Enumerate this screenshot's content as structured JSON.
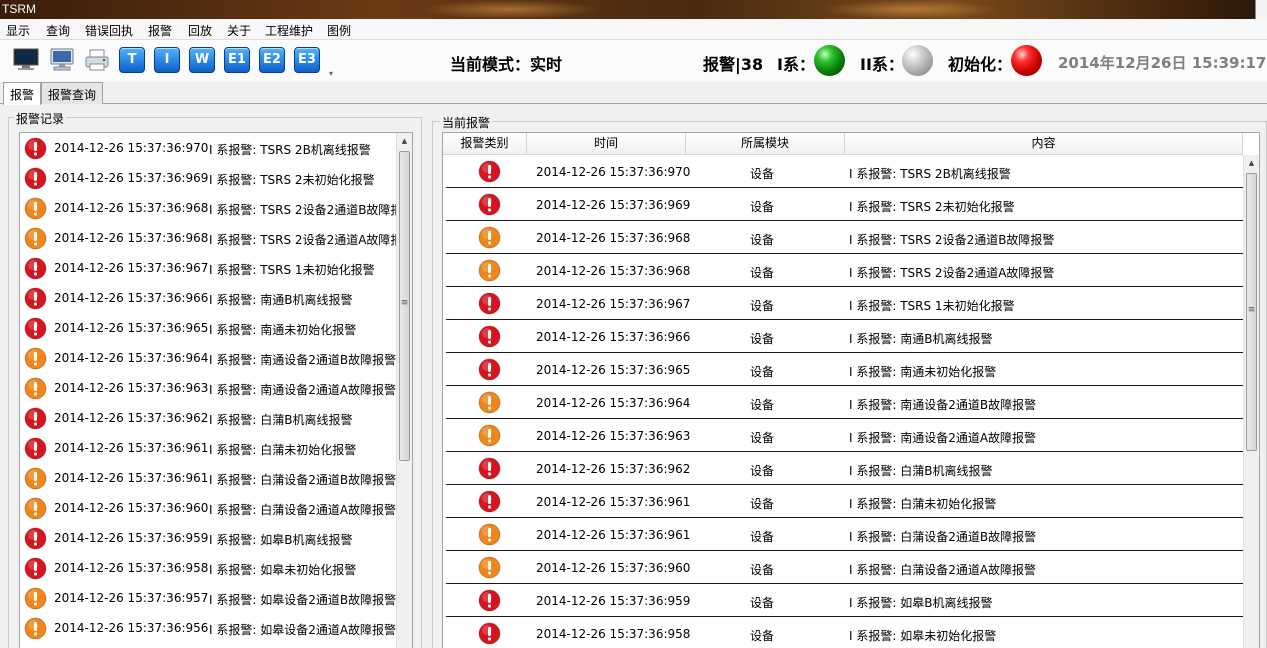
{
  "window": {
    "title": "TSRM"
  },
  "menu": [
    "显示",
    "查询",
    "错误回执",
    "报警",
    "回放",
    "关于",
    "工程维护",
    "图例"
  ],
  "toolbar": {
    "icons": [
      "monitor-icon",
      "computer-icon",
      "printer-icon"
    ],
    "letters": [
      "T",
      "I",
      "W",
      "E1",
      "E2",
      "E3"
    ]
  },
  "status": {
    "mode": "当前模式：实时",
    "alarm_count": "报警|38",
    "sys1_label": "I系：",
    "sys1_color": "#0a7a0a",
    "sys2_label": "II系：",
    "sys2_color": "#a4a4a4",
    "init_label": "初始化：",
    "init_color": "#c80000",
    "datetime": "2014年12月26日   15:39:17"
  },
  "tabs": [
    "报警",
    "报警查询"
  ],
  "left": {
    "group_title": "报警记录",
    "rows": [
      {
        "level": "red",
        "time": "2014-12-26 15:37:36:970",
        "content": "I 系报警: TSRS 2B机离线报警"
      },
      {
        "level": "red",
        "time": "2014-12-26 15:37:36:969",
        "content": "I 系报警: TSRS 2未初始化报警"
      },
      {
        "level": "orange",
        "time": "2014-12-26 15:37:36:968",
        "content": "I 系报警: TSRS 2设备2通道B故障报"
      },
      {
        "level": "orange",
        "time": "2014-12-26 15:37:36:968",
        "content": "I 系报警: TSRS 2设备2通道A故障报"
      },
      {
        "level": "red",
        "time": "2014-12-26 15:37:36:967",
        "content": "I 系报警: TSRS 1未初始化报警"
      },
      {
        "level": "red",
        "time": "2014-12-26 15:37:36:966",
        "content": "I 系报警: 南通B机离线报警"
      },
      {
        "level": "red",
        "time": "2014-12-26 15:37:36:965",
        "content": "I 系报警: 南通未初始化报警"
      },
      {
        "level": "orange",
        "time": "2014-12-26 15:37:36:964",
        "content": "I 系报警: 南通设备2通道B故障报警"
      },
      {
        "level": "orange",
        "time": "2014-12-26 15:37:36:963",
        "content": "I 系报警: 南通设备2通道A故障报警"
      },
      {
        "level": "red",
        "time": "2014-12-26 15:37:36:962",
        "content": "I 系报警: 白蒲B机离线报警"
      },
      {
        "level": "red",
        "time": "2014-12-26 15:37:36:961",
        "content": "I 系报警: 白蒲未初始化报警"
      },
      {
        "level": "orange",
        "time": "2014-12-26 15:37:36:961",
        "content": "I 系报警: 白蒲设备2通道B故障报警"
      },
      {
        "level": "orange",
        "time": "2014-12-26 15:37:36:960",
        "content": "I 系报警: 白蒲设备2通道A故障报警"
      },
      {
        "level": "red",
        "time": "2014-12-26 15:37:36:959",
        "content": "I 系报警: 如皋B机离线报警"
      },
      {
        "level": "red",
        "time": "2014-12-26 15:37:36:958",
        "content": "I 系报警: 如皋未初始化报警"
      },
      {
        "level": "orange",
        "time": "2014-12-26 15:37:36:957",
        "content": "I 系报警: 如皋设备2通道B故障报警"
      },
      {
        "level": "orange",
        "time": "2014-12-26 15:37:36:956",
        "content": "I 系报警: 如皋设备2通道A故障报警"
      }
    ]
  },
  "right": {
    "group_title": "当前报警",
    "columns": [
      "报警类别",
      "时间",
      "所属模块",
      "内容"
    ],
    "rows": [
      {
        "level": "red",
        "time": "2014-12-26 15:37:36:970",
        "module": "设备",
        "content": "I 系报警: TSRS 2B机离线报警"
      },
      {
        "level": "red",
        "time": "2014-12-26 15:37:36:969",
        "module": "设备",
        "content": "I 系报警: TSRS 2未初始化报警"
      },
      {
        "level": "orange",
        "time": "2014-12-26 15:37:36:968",
        "module": "设备",
        "content": "I 系报警: TSRS 2设备2通道B故障报警"
      },
      {
        "level": "orange",
        "time": "2014-12-26 15:37:36:968",
        "module": "设备",
        "content": "I 系报警: TSRS 2设备2通道A故障报警"
      },
      {
        "level": "red",
        "time": "2014-12-26 15:37:36:967",
        "module": "设备",
        "content": "I 系报警: TSRS 1未初始化报警"
      },
      {
        "level": "red",
        "time": "2014-12-26 15:37:36:966",
        "module": "设备",
        "content": "I 系报警: 南通B机离线报警"
      },
      {
        "level": "red",
        "time": "2014-12-26 15:37:36:965",
        "module": "设备",
        "content": "I 系报警: 南通未初始化报警"
      },
      {
        "level": "orange",
        "time": "2014-12-26 15:37:36:964",
        "module": "设备",
        "content": "I 系报警: 南通设备2通道B故障报警"
      },
      {
        "level": "orange",
        "time": "2014-12-26 15:37:36:963",
        "module": "设备",
        "content": "I 系报警: 南通设备2通道A故障报警"
      },
      {
        "level": "red",
        "time": "2014-12-26 15:37:36:962",
        "module": "设备",
        "content": "I 系报警: 白蒲B机离线报警"
      },
      {
        "level": "red",
        "time": "2014-12-26 15:37:36:961",
        "module": "设备",
        "content": "I 系报警: 白蒲未初始化报警"
      },
      {
        "level": "orange",
        "time": "2014-12-26 15:37:36:961",
        "module": "设备",
        "content": "I 系报警: 白蒲设备2通道B故障报警"
      },
      {
        "level": "orange",
        "time": "2014-12-26 15:37:36:960",
        "module": "设备",
        "content": "I 系报警: 白蒲设备2通道A故障报警"
      },
      {
        "level": "red",
        "time": "2014-12-26 15:37:36:959",
        "module": "设备",
        "content": "I 系报警: 如皋B机离线报警"
      },
      {
        "level": "red",
        "time": "2014-12-26 15:37:36:958",
        "module": "设备",
        "content": "I 系报警: 如皋未初始化报警"
      }
    ]
  },
  "colors": {
    "alarm_red": "#d8141e",
    "alarm_orange": "#f0861a"
  }
}
